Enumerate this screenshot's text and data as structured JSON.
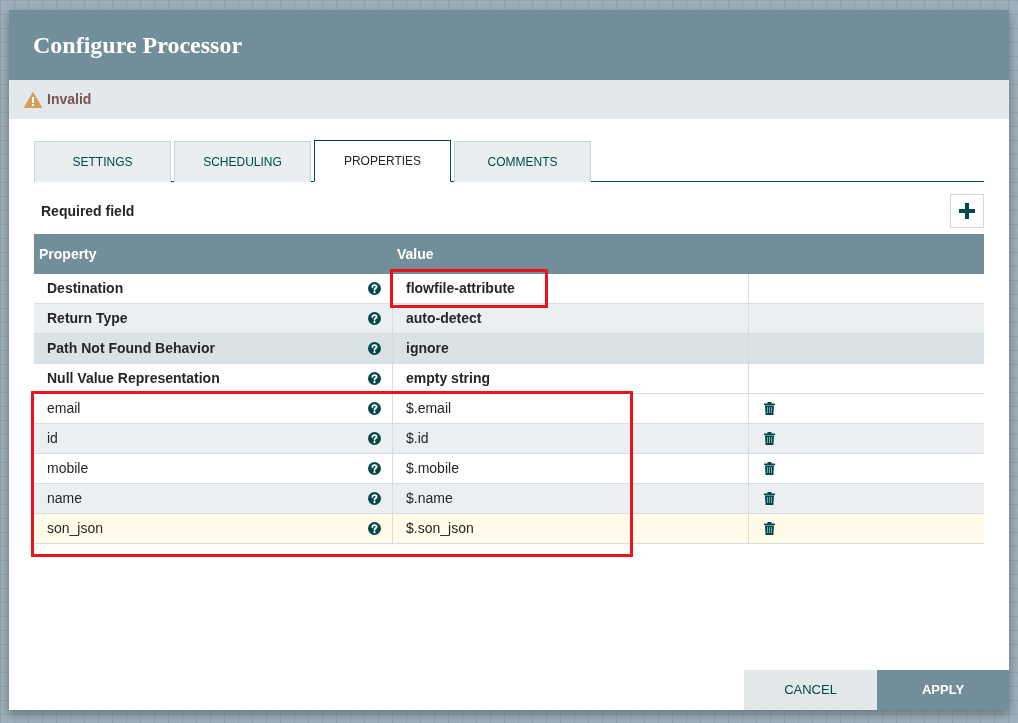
{
  "dialog": {
    "title": "Configure Processor",
    "status": {
      "kind": "warning",
      "text": "Invalid"
    }
  },
  "tabs": [
    {
      "label": "SETTINGS",
      "selected": false
    },
    {
      "label": "SCHEDULING",
      "selected": false
    },
    {
      "label": "PROPERTIES",
      "selected": true
    },
    {
      "label": "COMMENTS",
      "selected": false
    }
  ],
  "required_field_label": "Required field",
  "table": {
    "columns": [
      "Property",
      "Value"
    ],
    "rows": [
      {
        "property": "Destination",
        "value": "flowfile-attribute",
        "kind": "required",
        "striped": false,
        "hovered": false,
        "selected": false,
        "value_highlighted": true
      },
      {
        "property": "Return Type",
        "value": "auto-detect",
        "kind": "required",
        "striped": true,
        "hovered": false,
        "selected": false,
        "value_highlighted": false
      },
      {
        "property": "Path Not Found Behavior",
        "value": "ignore",
        "kind": "required",
        "striped": false,
        "hovered": true,
        "selected": false,
        "value_highlighted": false
      },
      {
        "property": "Null Value Representation",
        "value": "empty string",
        "kind": "required",
        "striped": false,
        "hovered": false,
        "selected": false,
        "value_highlighted": false
      }
    ],
    "highlighted_group": {
      "rows": [
        {
          "property": "email",
          "value": "$.email",
          "kind": "dynamic",
          "striped": false,
          "hovered": false,
          "selected": false
        },
        {
          "property": "id",
          "value": "$.id",
          "kind": "dynamic",
          "striped": true,
          "hovered": false,
          "selected": false
        },
        {
          "property": "mobile",
          "value": "$.mobile",
          "kind": "dynamic",
          "striped": false,
          "hovered": false,
          "selected": false
        },
        {
          "property": "name",
          "value": "$.name",
          "kind": "dynamic",
          "striped": true,
          "hovered": false,
          "selected": false
        },
        {
          "property": "son_json",
          "value": "$.son_json",
          "kind": "dynamic",
          "striped": false,
          "hovered": false,
          "selected": true
        }
      ]
    }
  },
  "buttons": [
    {
      "label": "CANCEL",
      "kind": "secondary"
    },
    {
      "label": "APPLY",
      "kind": "primary"
    }
  ]
}
